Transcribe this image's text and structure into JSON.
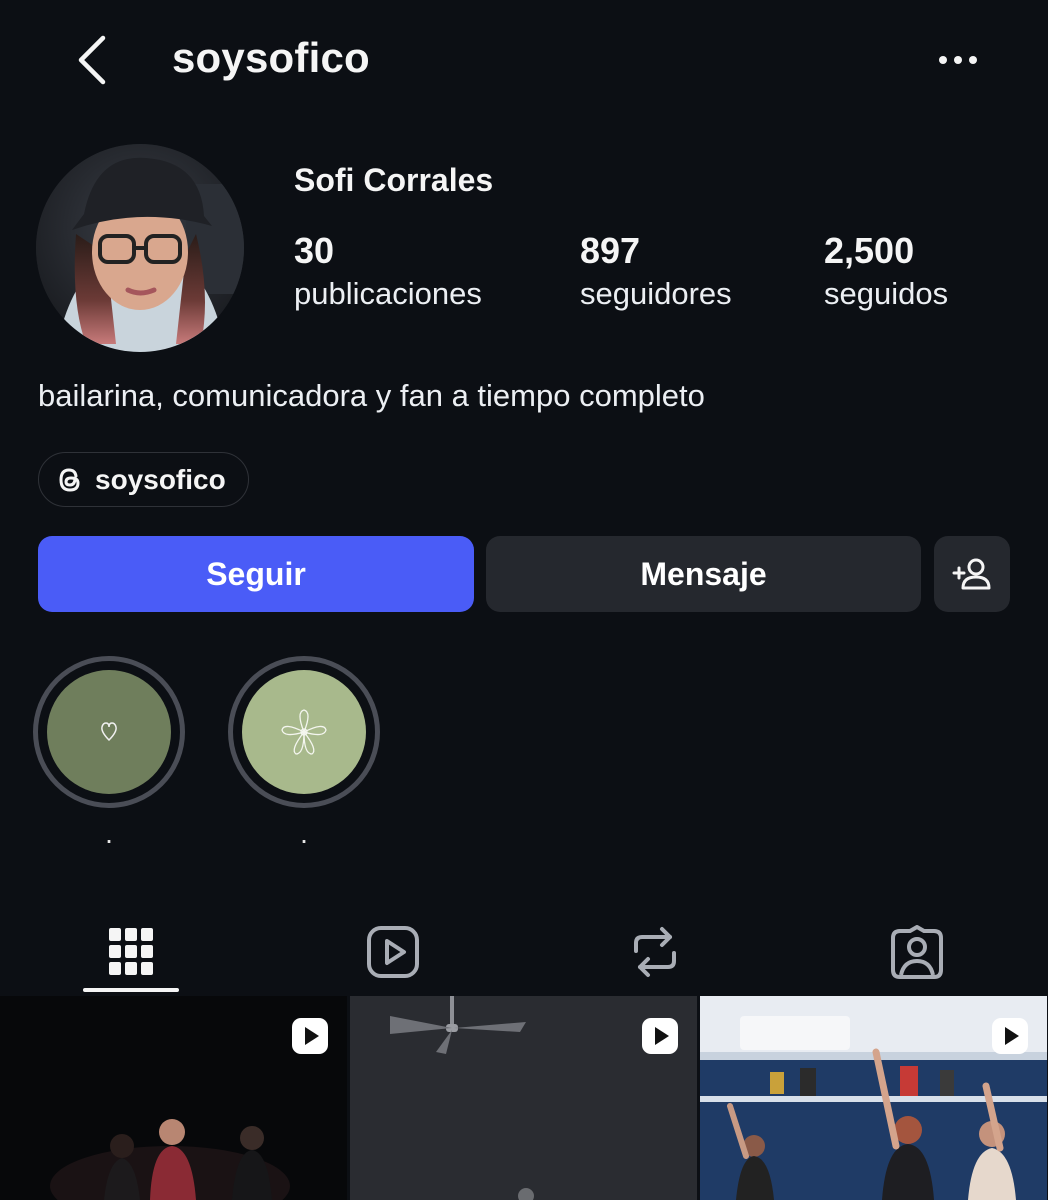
{
  "header": {
    "username": "soysofico",
    "back_icon": "chevron-left-icon",
    "more_icon": "more-horizontal-icon"
  },
  "profile": {
    "display_name": "Sofi Corrales",
    "stats": [
      {
        "value": "30",
        "label": "publicaciones"
      },
      {
        "value": "897",
        "label": "seguidores"
      },
      {
        "value": "2,500",
        "label": "seguidos"
      }
    ],
    "bio": "bailarina, comunicadora y fan a tiempo completo",
    "threads_handle": "soysofico"
  },
  "actions": {
    "follow_label": "Seguir",
    "message_label": "Mensaje",
    "add_user_icon": "add-user-icon"
  },
  "highlights": [
    {
      "label": ".",
      "icon": "heart-icon",
      "color": "#6f7e5c"
    },
    {
      "label": ".",
      "icon": "flower-icon",
      "color": "#a8b98c"
    }
  ],
  "tabs": [
    {
      "icon": "grid-icon",
      "selected": true
    },
    {
      "icon": "reels-icon",
      "selected": false
    },
    {
      "icon": "reposts-icon",
      "selected": false
    },
    {
      "icon": "tagged-icon",
      "selected": false
    }
  ],
  "posts": [
    {
      "type": "reel",
      "icon": "reel-icon"
    },
    {
      "type": "reel",
      "icon": "reel-icon"
    },
    {
      "type": "reel",
      "icon": "reel-icon"
    }
  ],
  "colors": {
    "background": "#0c0f14",
    "follow_button": "#4a5cf7",
    "secondary_button": "#25282e",
    "text": "#f5f5f5"
  }
}
